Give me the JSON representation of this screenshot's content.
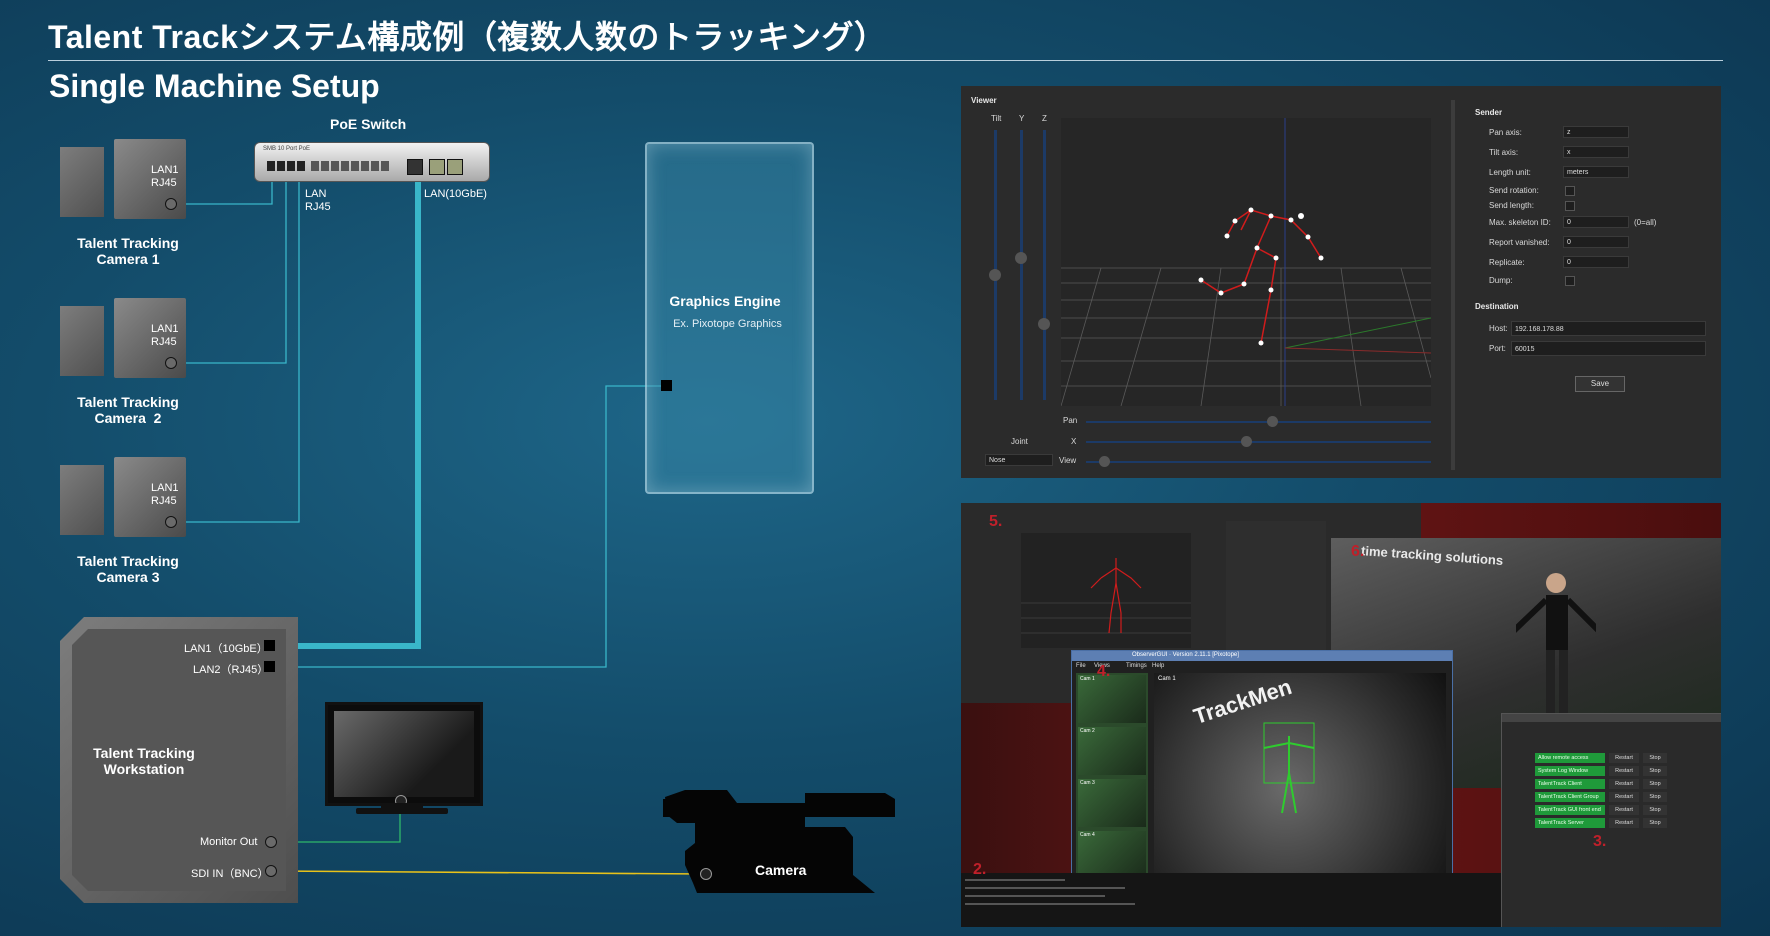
{
  "title": "Talent Trackシステム構成例（複数人数のトラッキング）",
  "subtitle": "Single Machine Setup",
  "poe_switch": {
    "label": "PoE Switch",
    "device_text": "SMB 10 Port PoE",
    "lan_label": "LAN\nRJ45",
    "lan10g_label": "LAN(10GbE)"
  },
  "cameras": [
    {
      "port": "LAN1\nRJ45",
      "name": "Talent Tracking\nCamera 1"
    },
    {
      "port": "LAN1\nRJ45",
      "name": "Talent Tracking\nCamera  2"
    },
    {
      "port": "LAN1\nRJ45",
      "name": "Talent Tracking\nCamera 3"
    }
  ],
  "graphics_engine": {
    "title": "Graphics Engine",
    "subtitle": "Ex. Pixotope Graphics"
  },
  "workstation": {
    "name": "Talent Tracking\nWorkstation",
    "ports": {
      "lan1": "LAN1（10GbE）",
      "lan2": "LAN2（RJ45）",
      "monitor_out": "Monitor Out",
      "sdi_in": "SDI IN（BNC）"
    }
  },
  "camera": {
    "label": "Camera"
  },
  "colors": {
    "cyan_link": "#39b6c9",
    "monitor_link": "#2fb86a",
    "sdi_link": "#e8c21a"
  },
  "viewer": {
    "title": "Viewer",
    "axes": [
      "Tilt",
      "Y",
      "Z"
    ],
    "pan_label": "Pan",
    "joint_label": "Joint",
    "x_label": "X",
    "view_label": "View",
    "joint_value": "Nose"
  },
  "sender": {
    "title": "Sender",
    "fields": [
      {
        "label": "Pan axis:",
        "value": "z"
      },
      {
        "label": "Tilt axis:",
        "value": "x"
      },
      {
        "label": "Length unit:",
        "value": "meters"
      }
    ],
    "checks": [
      "Send rotation:",
      "Send length:"
    ],
    "spins": [
      {
        "label": "Max. skeleton ID:",
        "value": "0",
        "note": "(0=all)"
      },
      {
        "label": "Report vanished:",
        "value": "0"
      },
      {
        "label": "Replicate:",
        "value": "0"
      }
    ],
    "dump_label": "Dump:",
    "destination_title": "Destination",
    "host_label": "Host:",
    "host_value": "192.168.178.88",
    "port_label": "Port:",
    "port_value": "60015",
    "save_label": "Save"
  },
  "collage": {
    "markers": [
      "5.",
      "6.",
      "4.",
      "2.",
      "3."
    ],
    "tagline": "time tracking solutions",
    "observer_title": "ObserverGUI · Version 2.11.1 [Pixotope]",
    "menu": [
      "File",
      "Views",
      "Timings",
      "Help"
    ],
    "cam_label": "Cam 1",
    "brand": "TrackMen",
    "thumb_labels": [
      "Cam 1",
      "Cam 2",
      "Cam 3",
      "Cam 4"
    ],
    "services": [
      {
        "name": "Allow remote access",
        "restart": "Restart",
        "stop": "Stop"
      },
      {
        "name": "System Log Window",
        "restart": "Restart",
        "stop": "Stop"
      },
      {
        "name": "TalentTrack Client",
        "restart": "Restart",
        "stop": "Stop"
      },
      {
        "name": "TalentTrack Client Group",
        "restart": "Restart",
        "stop": "Stop"
      },
      {
        "name": "TalentTrack GUI front end",
        "restart": "Restart",
        "stop": "Stop"
      },
      {
        "name": "TalentTrack Server",
        "restart": "Restart",
        "stop": "Stop"
      }
    ]
  }
}
